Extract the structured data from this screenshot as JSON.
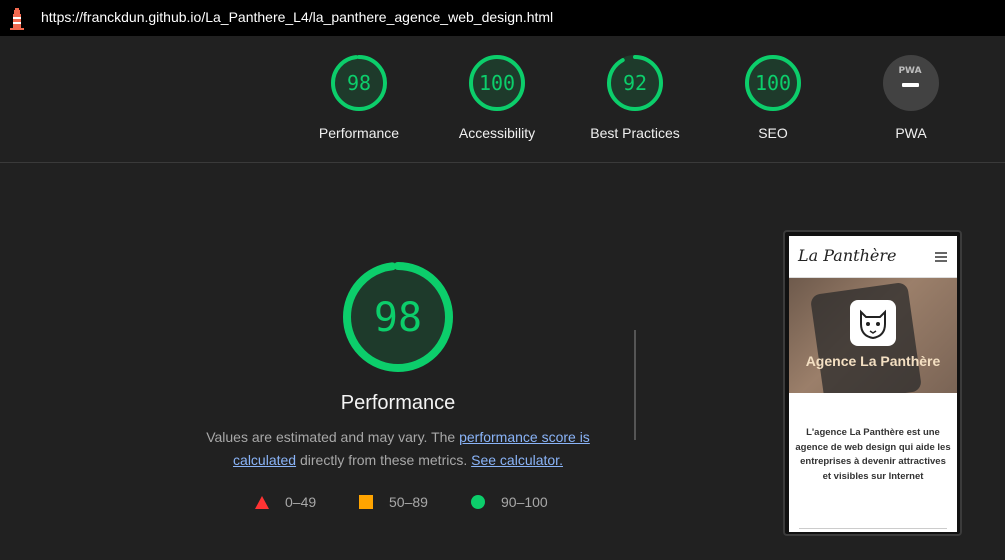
{
  "browser": {
    "url": "https://franckdun.github.io/La_Panthere_L4/la_panthere_agence_web_design.html"
  },
  "categories": [
    {
      "label": "Performance",
      "score": "98",
      "value": 98
    },
    {
      "label": "Accessibility",
      "score": "100",
      "value": 100
    },
    {
      "label": "Best Practices",
      "score": "92",
      "value": 92
    },
    {
      "label": "SEO",
      "score": "100",
      "value": 100
    },
    {
      "label": "PWA",
      "badge": "PWA"
    }
  ],
  "main": {
    "score": "98",
    "score_value": 98,
    "title": "Performance",
    "desc_before": "Values are estimated and may vary. The ",
    "link_score": "performance score is calculated",
    "desc_middle": " directly from these metrics. ",
    "link_calc": "See calculator.",
    "legend": [
      {
        "range": "0–49",
        "shape": "triangle",
        "color": "#ff3333"
      },
      {
        "range": "50–89",
        "shape": "square",
        "color": "#ffa400"
      },
      {
        "range": "90–100",
        "shape": "circle",
        "color": "#0cce6b"
      }
    ]
  },
  "preview": {
    "site_title": "La Panthère",
    "hero_title": "Agence La Panthère",
    "intro": "L'agence La Panthère est une agence de web design qui aide les entreprises à devenir attractives et visibles sur Internet"
  },
  "colors": {
    "pass": "#0cce6b",
    "pass_bg": "#1e3a2b",
    "pwa_bg": "#424242"
  }
}
